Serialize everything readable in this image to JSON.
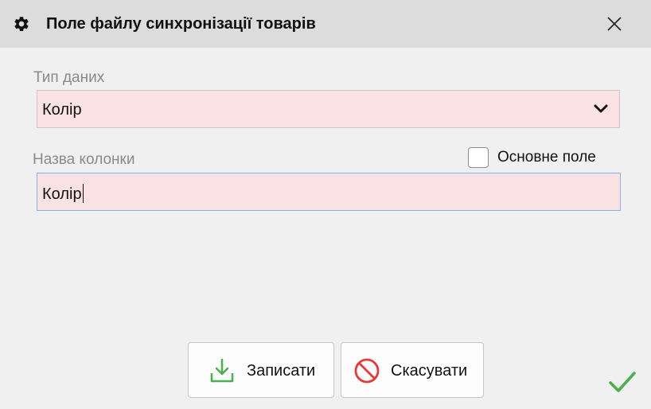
{
  "window": {
    "title": "Поле файлу синхронізації товарів",
    "title_icon": "gear-icon",
    "close_icon": "close-icon"
  },
  "form": {
    "data_type": {
      "label": "Тип даних",
      "value": "Колір",
      "chevron_icon": "chevron-down-icon"
    },
    "column_name": {
      "label": "Назва колонки",
      "value": "Колір"
    },
    "primary_field": {
      "label": "Основне поле",
      "checked": false
    }
  },
  "buttons": {
    "save": {
      "label": "Записати",
      "icon": "download-icon",
      "icon_color": "#4caf50"
    },
    "cancel": {
      "label": "Скасувати",
      "icon": "forbidden-icon",
      "icon_color": "#e53935"
    },
    "confirm_icon": "checkmark-icon",
    "confirm_color": "#4caf50"
  },
  "colors": {
    "required_field_bg": "#fbe2e2",
    "focus_border": "#7fb4e8",
    "titlebar_bg": "#dcdcdc"
  }
}
